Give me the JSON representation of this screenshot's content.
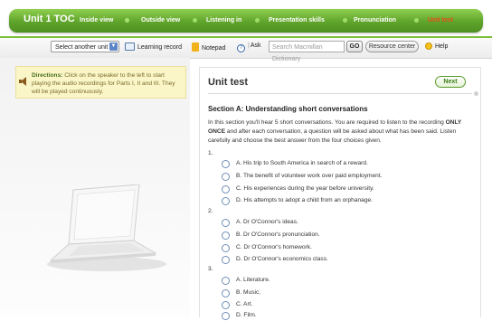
{
  "topnav": {
    "unit_label": "Unit 1 TOC",
    "items": [
      "Inside view",
      "Outside view",
      "Listening in",
      "Presentation skills",
      "Pronunciation",
      "Unit test"
    ],
    "active_index": 5
  },
  "toolbar": {
    "select_unit": "Select another unit",
    "learning_record": "Learning record",
    "notepad": "Notepad",
    "ask": "Ask",
    "search_placeholder": "Search Macmillan Dictionary",
    "go": "GO",
    "resource_center": "Resource center",
    "help": "Help"
  },
  "directions": {
    "label": "Directions:",
    "text": "Click on the speaker to the left to start playing the audio recordings for Parts I, II and III. They will be played continuously."
  },
  "content": {
    "title": "Unit test",
    "next": "Next",
    "section_title": "Section A: Understanding short conversations",
    "intro_pre": "In this section you'll hear 5 short conversations. You are required to listen to the recording ",
    "intro_bold": "ONLY ONCE",
    "intro_post": " and after each conversation, a question will be asked about what has been said. Listen carefully and choose the best answer from the four choices given.",
    "questions": [
      {
        "number": "1.",
        "options": [
          "A. His trip to South America in search of a reward.",
          "B. The benefit of volunteer work over paid employment.",
          "C. His experiences during the year before university.",
          "D. His attempts to adopt a child from an orphanage."
        ]
      },
      {
        "number": "2.",
        "options": [
          "A. Dr O'Connor's ideas.",
          "B. Dr O'Connor's pronunciation.",
          "C. Dr O'Connor's homework.",
          "D. Dr O'Connor's economics class."
        ]
      },
      {
        "number": "3.",
        "options": [
          "A. Literature.",
          "B. Music.",
          "C. Art.",
          "D. Film."
        ]
      }
    ]
  },
  "colors": {
    "nav_green": "#5fa42b",
    "active_tab": "#e84b1b",
    "directions_bg": "#faf6c8",
    "next_green": "#3d7d15"
  }
}
